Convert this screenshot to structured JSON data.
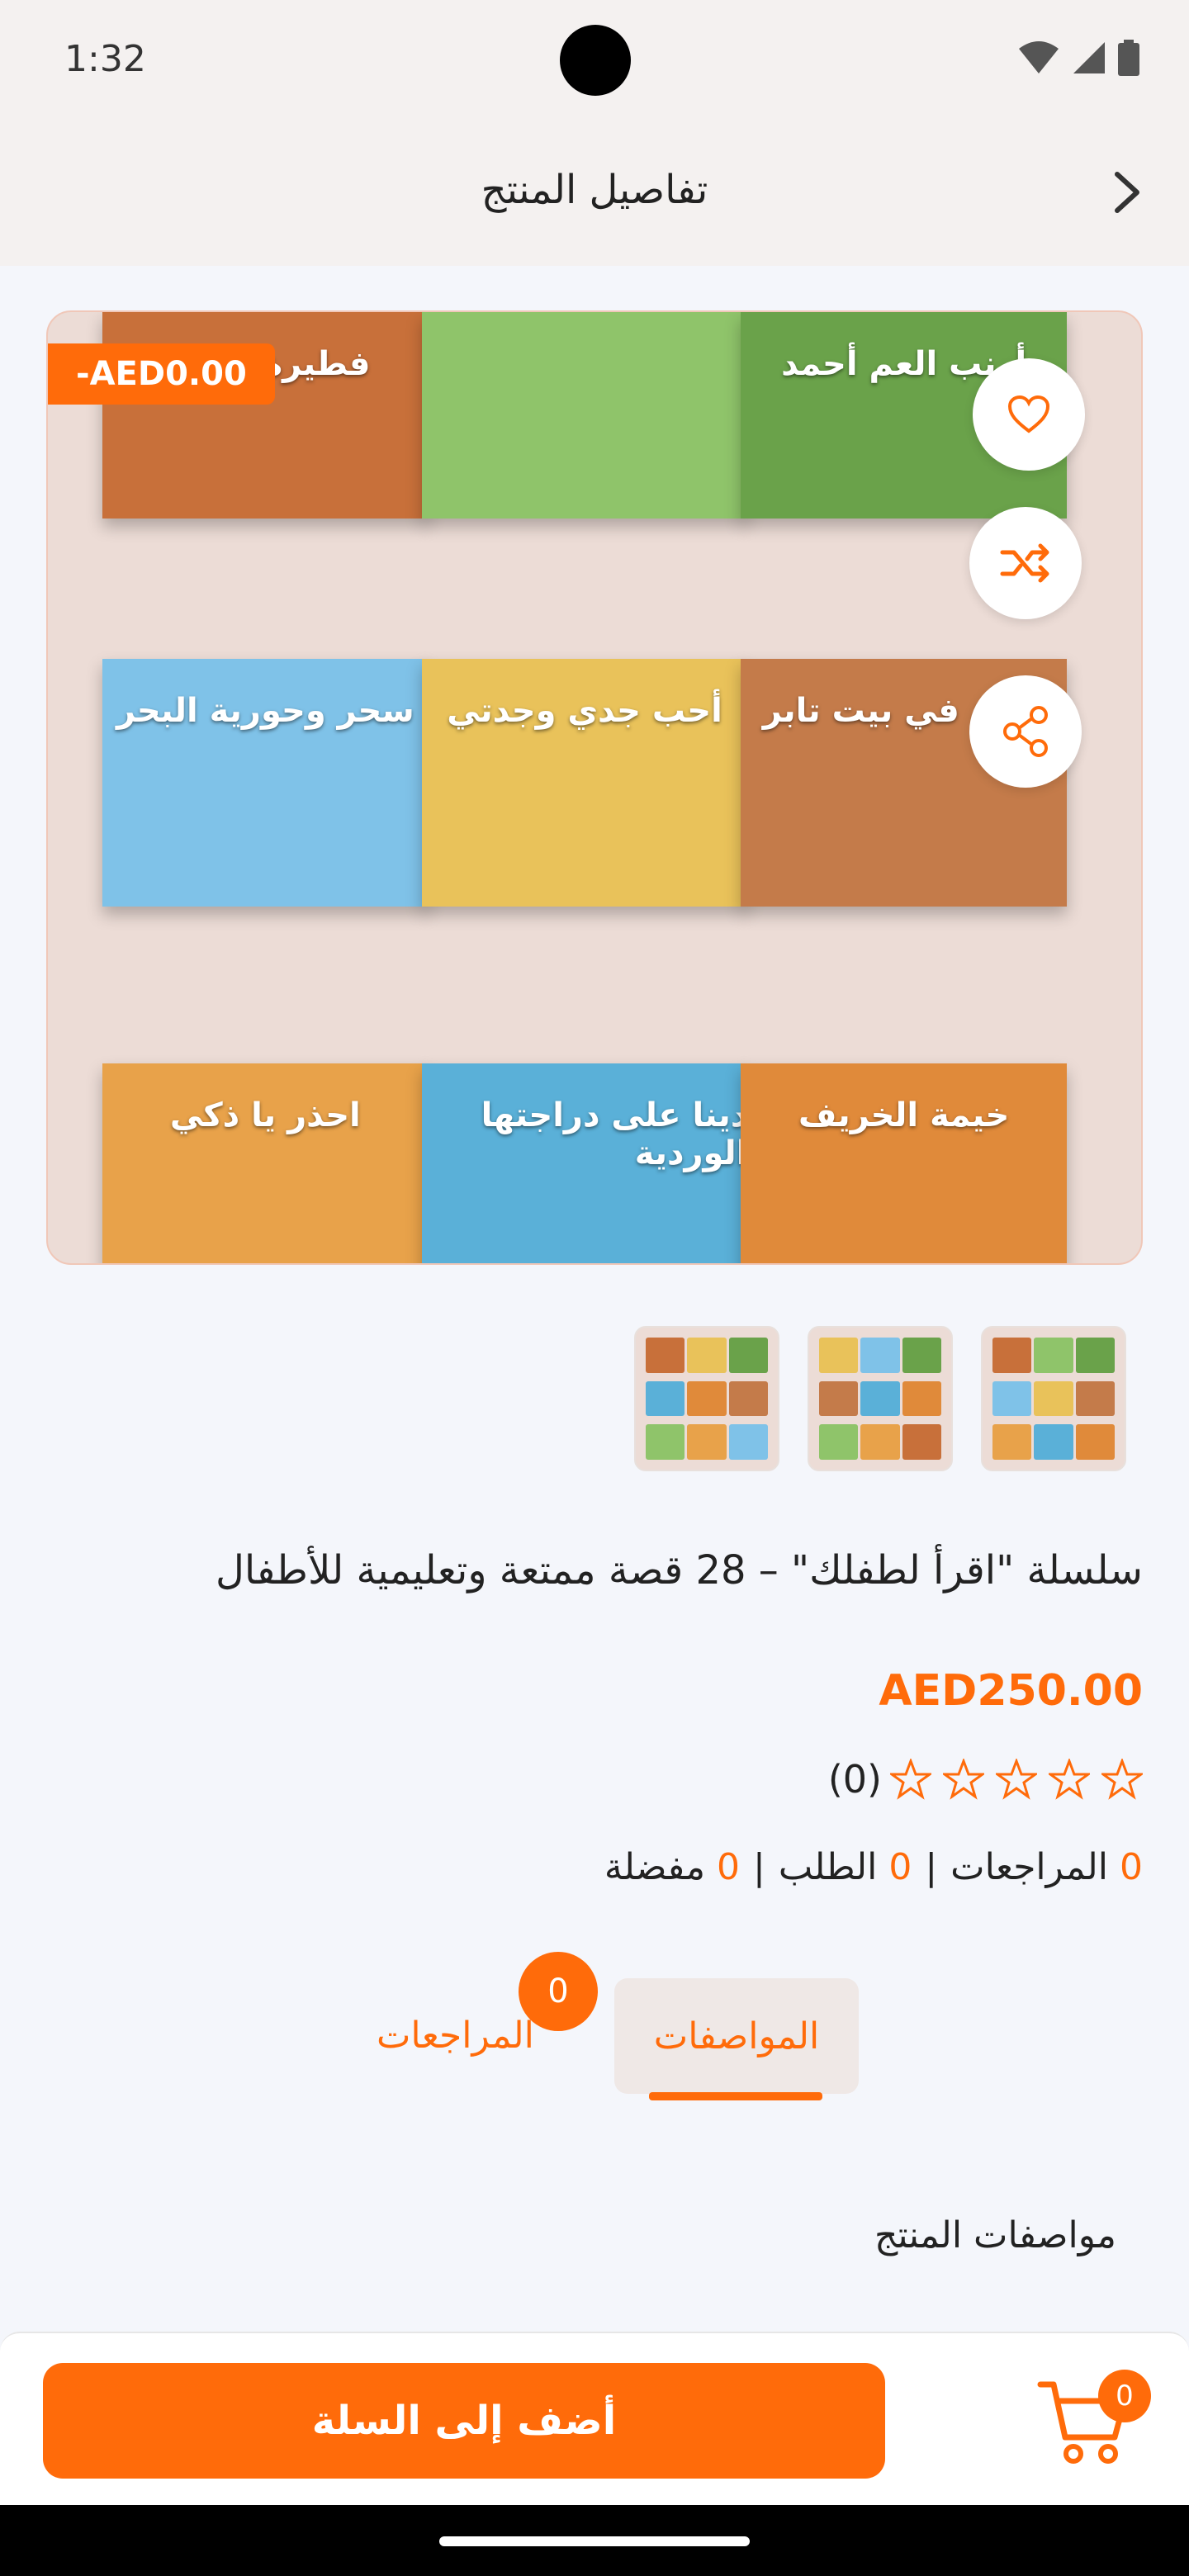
{
  "status_bar": {
    "time": "1:32"
  },
  "header": {
    "title": "تفاصيل المنتج"
  },
  "gallery": {
    "discount_badge": "-AED0.00",
    "books": [
      {
        "title": "فطيرة التوت",
        "color": "#c8703a"
      },
      {
        "title": "",
        "color": "#8fc46a"
      },
      {
        "title": "أرنب العم أحمد",
        "color": "#6aa24a"
      },
      {
        "title": "سحر وحورية البحر",
        "color": "#7fc2e8"
      },
      {
        "title": "أحب جدي وجدتي",
        "color": "#e9c25a"
      },
      {
        "title": "قصة في بيت تابر",
        "color": "#c47b4a"
      },
      {
        "title": "احذر يا ذكي",
        "color": "#e8a24a"
      },
      {
        "title": "دينا على دراجتها الوردية",
        "color": "#5ab0d8"
      },
      {
        "title": "خيمة الخريف",
        "color": "#e08a3a"
      }
    ]
  },
  "product": {
    "title": "سلسلة \"اقرأ لطفلك\" – 28 قصة ممتعة وتعليمية للأطفال",
    "price": "AED250.00",
    "rating_count": "(0)",
    "stats": {
      "reviews_num": "0",
      "reviews_label": "المراجعات",
      "orders_num": "0",
      "orders_label": "الطلب",
      "favorites_num": "0",
      "favorites_label": "مفضلة",
      "separator": "|"
    }
  },
  "tabs": {
    "specs_label": "المواصفات",
    "reviews_label": "المراجعات",
    "reviews_badge": "0"
  },
  "section": {
    "specs_title": "مواصفات المنتج"
  },
  "bottom": {
    "add_to_cart": "أضف إلى السلة",
    "cart_count": "0"
  },
  "colors": {
    "accent": "#ff6b0a"
  },
  "icons": [
    "wifi-icon",
    "signal-icon",
    "battery-icon",
    "chevron-right-icon",
    "heart-icon",
    "shuffle-icon",
    "share-icon",
    "star-icon",
    "cart-icon"
  ]
}
